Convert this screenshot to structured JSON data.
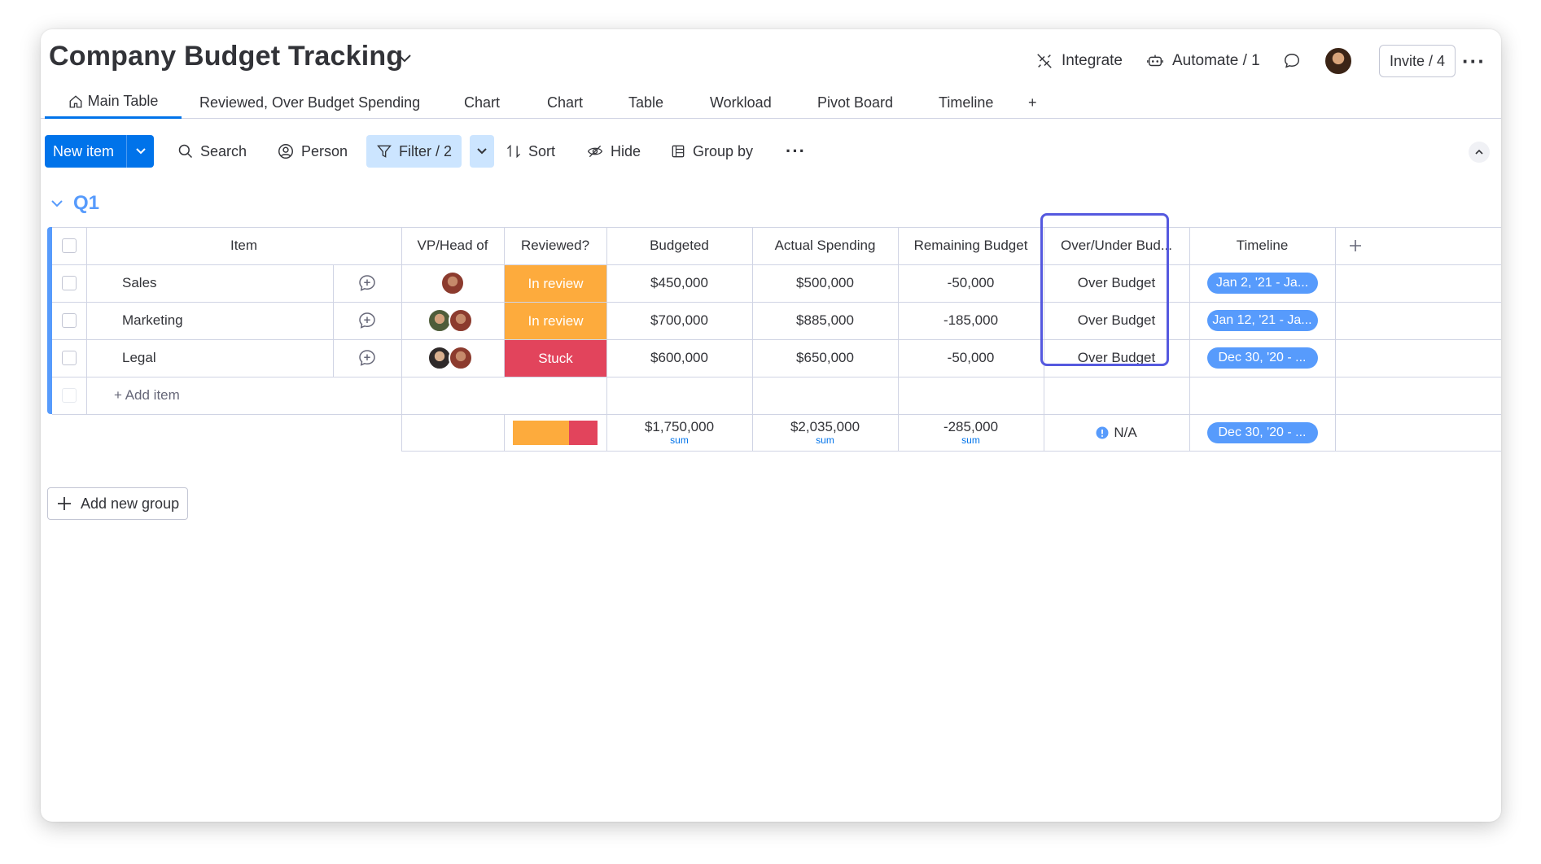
{
  "board": {
    "title": "Company Budget Tracking"
  },
  "header": {
    "integrate": "Integrate",
    "automate": "Automate / 1",
    "invite": "Invite / 4"
  },
  "tabs": [
    {
      "label": "Main Table"
    },
    {
      "label": "Reviewed, Over Budget Spending"
    },
    {
      "label": "Chart"
    },
    {
      "label": "Chart"
    },
    {
      "label": "Table"
    },
    {
      "label": "Workload"
    },
    {
      "label": "Pivot Board"
    },
    {
      "label": "Timeline"
    },
    {
      "label": "+"
    }
  ],
  "toolbar": {
    "new_item": "New item",
    "search": "Search",
    "person": "Person",
    "filter": "Filter / 2",
    "sort": "Sort",
    "hide": "Hide",
    "group_by": "Group by"
  },
  "group": {
    "name": "Q1",
    "columns": {
      "item": "Item",
      "vp": "VP/Head of",
      "reviewed": "Reviewed?",
      "budgeted": "Budgeted",
      "actual": "Actual Spending",
      "remaining": "Remaining Budget",
      "over_under": "Over/Under Bud...",
      "timeline": "Timeline"
    },
    "rows": [
      {
        "item": "Sales",
        "status": "In review",
        "status_color": "#fdab3d",
        "budgeted": "$450,000",
        "actual": "$500,000",
        "remaining": "-50,000",
        "over_under": "Over Budget",
        "timeline": "Jan 2, '21 - Ja..."
      },
      {
        "item": "Marketing",
        "status": "In review",
        "status_color": "#fdab3d",
        "budgeted": "$700,000",
        "actual": "$885,000",
        "remaining": "-185,000",
        "over_under": "Over Budget",
        "timeline": "Jan 12, '21 - Ja..."
      },
      {
        "item": "Legal",
        "status": "Stuck",
        "status_color": "#e2445c",
        "budgeted": "$600,000",
        "actual": "$650,000",
        "remaining": "-50,000",
        "over_under": "Over Budget",
        "timeline": "Dec 30, '20 - ..."
      }
    ],
    "add_item": "+ Add item",
    "summary": {
      "budgeted": "$1,750,000",
      "actual": "$2,035,000",
      "remaining": "-285,000",
      "sum_label": "sum",
      "over_under": "N/A",
      "timeline": "Dec 30, '20 - ...",
      "status_split": {
        "in_review": 0.667,
        "stuck": 0.333
      }
    }
  },
  "add_group": "Add new group",
  "colors": {
    "primary": "#0073ea",
    "group": "#579bfc",
    "in_review": "#fdab3d",
    "stuck": "#e2445c",
    "highlight": "#5559df"
  }
}
